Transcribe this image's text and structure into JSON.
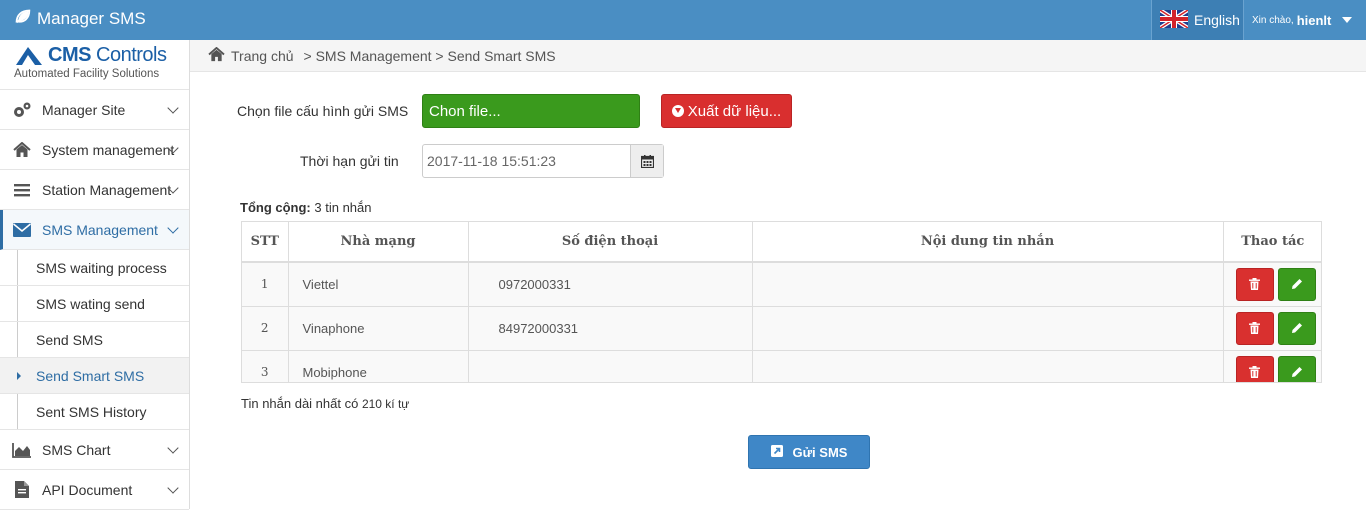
{
  "app": {
    "title": "Manager SMS"
  },
  "topbar": {
    "language": "English",
    "greeting": "Xin chào,",
    "username": "hienlt"
  },
  "logo": {
    "name_bold": "CMS",
    "name_rest": "Controls",
    "tagline": "Automated Facility Solutions"
  },
  "sidebar": {
    "items": [
      {
        "label": "Manager Site",
        "icon": "gears-icon"
      },
      {
        "label": "System management",
        "icon": "home-icon"
      },
      {
        "label": "Station Management",
        "icon": "bars-icon"
      },
      {
        "label": "SMS Management",
        "icon": "envelope-icon"
      },
      {
        "label": "SMS Chart",
        "icon": "area-chart-icon"
      },
      {
        "label": "API Document",
        "icon": "file-icon"
      }
    ],
    "sub_items": [
      {
        "label": "SMS waiting process"
      },
      {
        "label": "SMS wating send"
      },
      {
        "label": "Send SMS"
      },
      {
        "label": "Send Smart SMS"
      },
      {
        "label": "Sent SMS History"
      }
    ]
  },
  "breadcrumb": {
    "home": "Trang chủ",
    "path": "> SMS Management > Send Smart SMS"
  },
  "form": {
    "file_label": "Chọn file cấu hình gửi SMS",
    "file_button": "Chon file...",
    "export_button": "Xuất dữ liệu...",
    "deadline_label": "Thời hạn gửi tin",
    "deadline_value": "2017-11-18 15:51:23"
  },
  "summary": {
    "total_label": "Tổng cộng:",
    "total_value": "3 tin nhắn"
  },
  "table": {
    "headers": [
      "STT",
      "Nhà mạng",
      "Số điện thoại",
      "Nội dung tin nhắn",
      "Thao tác"
    ],
    "rows": [
      {
        "stt": "1",
        "network": "Viettel",
        "phone": "0972000331",
        "content": ""
      },
      {
        "stt": "2",
        "network": "Vinaphone",
        "phone": "84972000331",
        "content": ""
      },
      {
        "stt": "3",
        "network": "Mobiphone",
        "phone": "",
        "content": ""
      }
    ]
  },
  "footer": {
    "maxlen_label": "Tin nhắn dài nhất có",
    "maxlen_value": "210 kí tự",
    "send_button": "Gửi SMS"
  },
  "colors": {
    "topbar": "#4a8ec3",
    "green": "#3a9a1d",
    "red": "#d92f2f",
    "blue": "#3f87c7"
  }
}
